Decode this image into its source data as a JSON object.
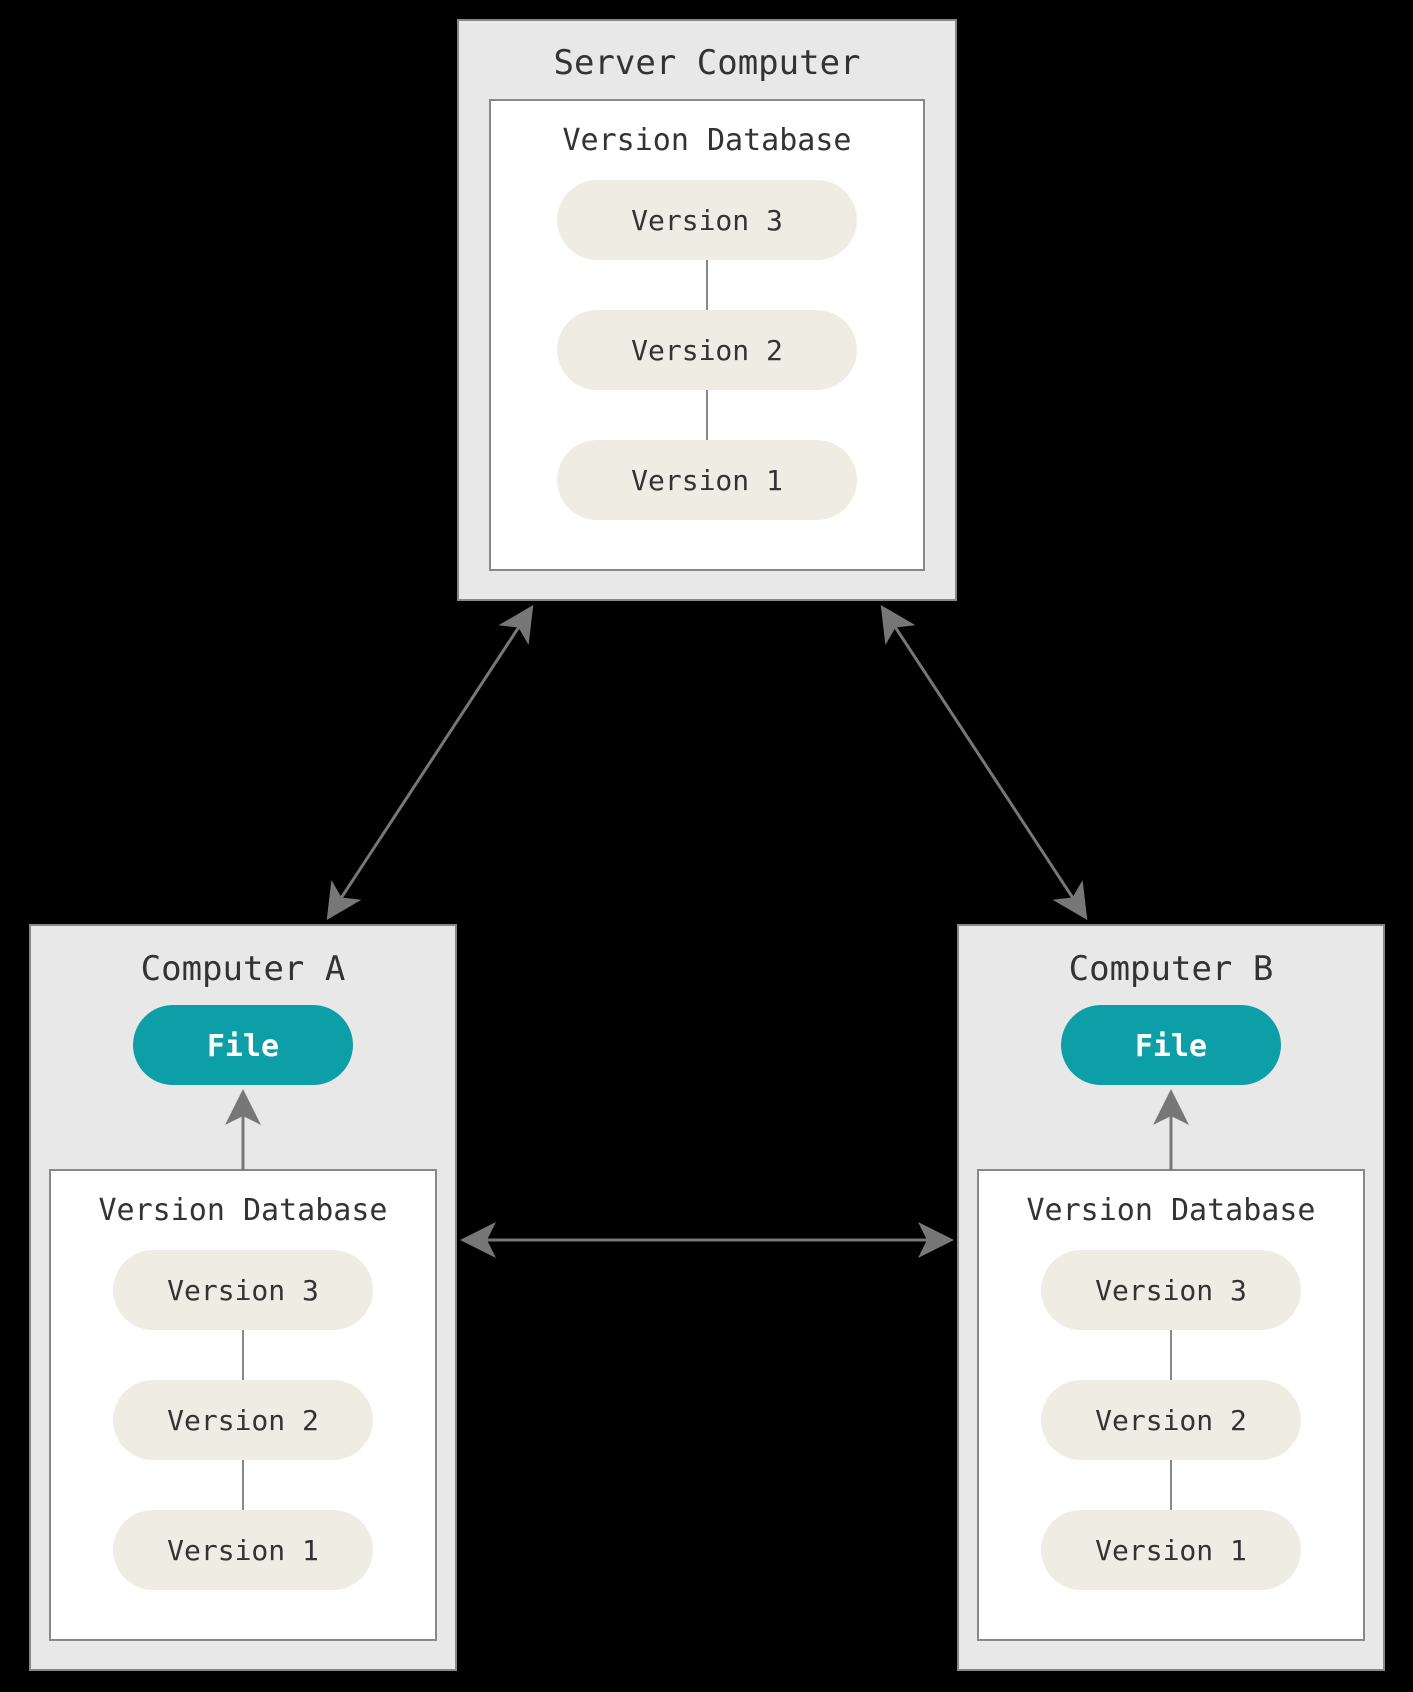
{
  "server": {
    "title": "Server Computer",
    "db_label": "Version Database",
    "versions": [
      "Version 3",
      "Version 2",
      "Version 1"
    ]
  },
  "clientA": {
    "title": "Computer A",
    "file_label": "File",
    "db_label": "Version Database",
    "versions": [
      "Version 3",
      "Version 2",
      "Version 1"
    ]
  },
  "clientB": {
    "title": "Computer B",
    "file_label": "File",
    "db_label": "Version Database",
    "versions": [
      "Version 3",
      "Version 2",
      "Version 1"
    ]
  },
  "colors": {
    "accent": "#0d9fa7",
    "pill_bg": "#efede3",
    "box_bg": "#e8e8e8",
    "stroke": "#888"
  }
}
